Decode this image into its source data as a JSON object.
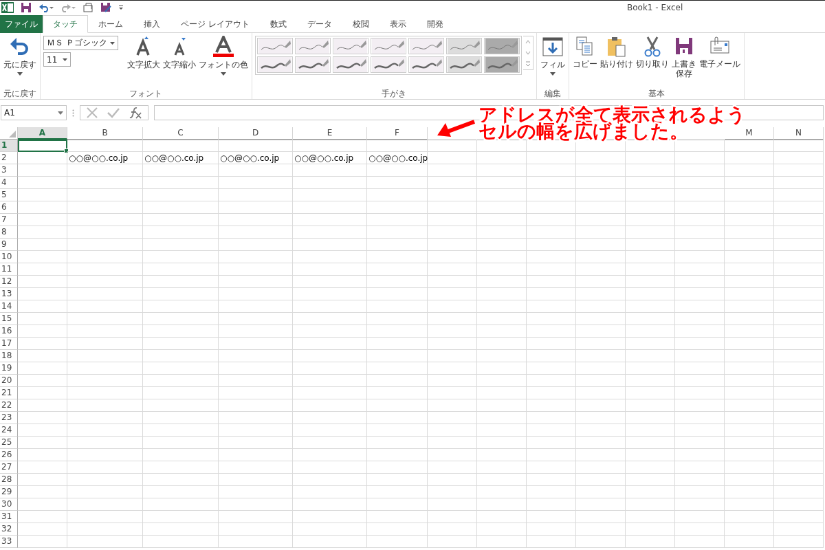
{
  "window": {
    "title": "Book1 - Excel"
  },
  "tabs": [
    {
      "label": "ファイル",
      "kind": "file",
      "selected": false
    },
    {
      "label": "タッチ",
      "kind": "tab",
      "selected": true
    },
    {
      "label": "ホーム",
      "kind": "tab",
      "selected": false
    },
    {
      "label": "挿入",
      "kind": "tab",
      "selected": false
    },
    {
      "label": "ページ レイアウト",
      "kind": "tab",
      "selected": false
    },
    {
      "label": "数式",
      "kind": "tab",
      "selected": false
    },
    {
      "label": "データ",
      "kind": "tab",
      "selected": false
    },
    {
      "label": "校閲",
      "kind": "tab",
      "selected": false
    },
    {
      "label": "表示",
      "kind": "tab",
      "selected": false
    },
    {
      "label": "開発",
      "kind": "tab",
      "selected": false
    }
  ],
  "ribbon": {
    "undo_group": {
      "button": "元に戻す",
      "label": "元に戻す"
    },
    "font_group": {
      "font_name": "ＭＳ Ｐゴシック",
      "font_size": "11",
      "buttons": [
        "文字拡大",
        "文字縮小",
        "フォントの色"
      ],
      "label": "フォント"
    },
    "handwriting_group": {
      "label": "手がき"
    },
    "edit_group": {
      "button": "フィル",
      "label": "編集"
    },
    "basic_group": {
      "buttons": [
        {
          "lines": [
            "コピー"
          ]
        },
        {
          "lines": [
            "貼り付け"
          ]
        },
        {
          "lines": [
            "切り取り"
          ]
        },
        {
          "lines": [
            "上書き",
            "保存"
          ]
        },
        {
          "lines": [
            "電子メール"
          ]
        }
      ],
      "label": "基本"
    }
  },
  "formula_bar": {
    "name_box": "A1"
  },
  "sheet": {
    "columns": [
      {
        "label": "A",
        "selected": true
      },
      {
        "label": "B",
        "selected": false
      },
      {
        "label": "C",
        "selected": false
      },
      {
        "label": "D",
        "selected": false
      },
      {
        "label": "E",
        "selected": false
      },
      {
        "label": "F",
        "selected": false
      },
      {
        "selected": false
      },
      {
        "selected": false
      },
      {
        "selected": false
      },
      {
        "selected": false
      },
      {
        "selected": false
      },
      {
        "selected": false
      },
      {
        "label": "M",
        "selected": false
      },
      {
        "label": "N",
        "selected": false
      }
    ],
    "rows": [
      {
        "header": "1",
        "selected": true,
        "cells": []
      },
      {
        "header": "2",
        "selected": false,
        "cells": [
          {
            "kind": "empty"
          },
          {
            "kind": "text",
            "text": "○○@○○.co.jp"
          },
          {
            "kind": "text",
            "text": "○○@○○.co.jp"
          },
          {
            "kind": "text",
            "text": "○○@○○.co.jp"
          },
          {
            "kind": "text",
            "text": "○○@○○.co.jp"
          },
          {
            "kind": "text",
            "text": "○○@○○.co.jp"
          }
        ]
      },
      {
        "header": "3",
        "selected": false,
        "cells": []
      },
      {
        "header": "4",
        "selected": false,
        "cells": []
      },
      {
        "header": "5",
        "selected": false,
        "cells": []
      },
      {
        "header": "6",
        "selected": false,
        "cells": []
      },
      {
        "header": "7",
        "selected": false,
        "cells": []
      },
      {
        "header": "8",
        "selected": false,
        "cells": []
      },
      {
        "header": "9",
        "selected": false,
        "cells": []
      },
      {
        "header": "10",
        "selected": false,
        "cells": []
      },
      {
        "header": "11",
        "selected": false,
        "cells": []
      },
      {
        "header": "12",
        "selected": false,
        "cells": []
      },
      {
        "header": "13",
        "selected": false,
        "cells": []
      },
      {
        "header": "14",
        "selected": false,
        "cells": []
      },
      {
        "header": "15",
        "selected": false,
        "cells": []
      },
      {
        "header": "16",
        "selected": false,
        "cells": []
      },
      {
        "header": "17",
        "selected": false,
        "cells": []
      },
      {
        "header": "18",
        "selected": false,
        "cells": []
      },
      {
        "header": "19",
        "selected": false,
        "cells": []
      },
      {
        "header": "20",
        "selected": false,
        "cells": []
      },
      {
        "header": "21",
        "selected": false,
        "cells": []
      },
      {
        "header": "22",
        "selected": false,
        "cells": []
      },
      {
        "header": "23",
        "selected": false,
        "cells": []
      },
      {
        "header": "24",
        "selected": false,
        "cells": []
      },
      {
        "header": "25",
        "selected": false,
        "cells": []
      },
      {
        "header": "26",
        "selected": false,
        "cells": []
      },
      {
        "header": "27",
        "selected": false,
        "cells": []
      },
      {
        "header": "28",
        "selected": false,
        "cells": []
      },
      {
        "header": "29",
        "selected": false,
        "cells": []
      },
      {
        "header": "30",
        "selected": false,
        "cells": []
      },
      {
        "header": "31",
        "selected": false,
        "cells": []
      },
      {
        "header": "32",
        "selected": false,
        "cells": []
      },
      {
        "header": "33",
        "selected": false,
        "cells": []
      }
    ]
  },
  "annotation": {
    "lines": [
      "アドレスが全て表示されるよう",
      "セルの幅を広げました。"
    ]
  }
}
